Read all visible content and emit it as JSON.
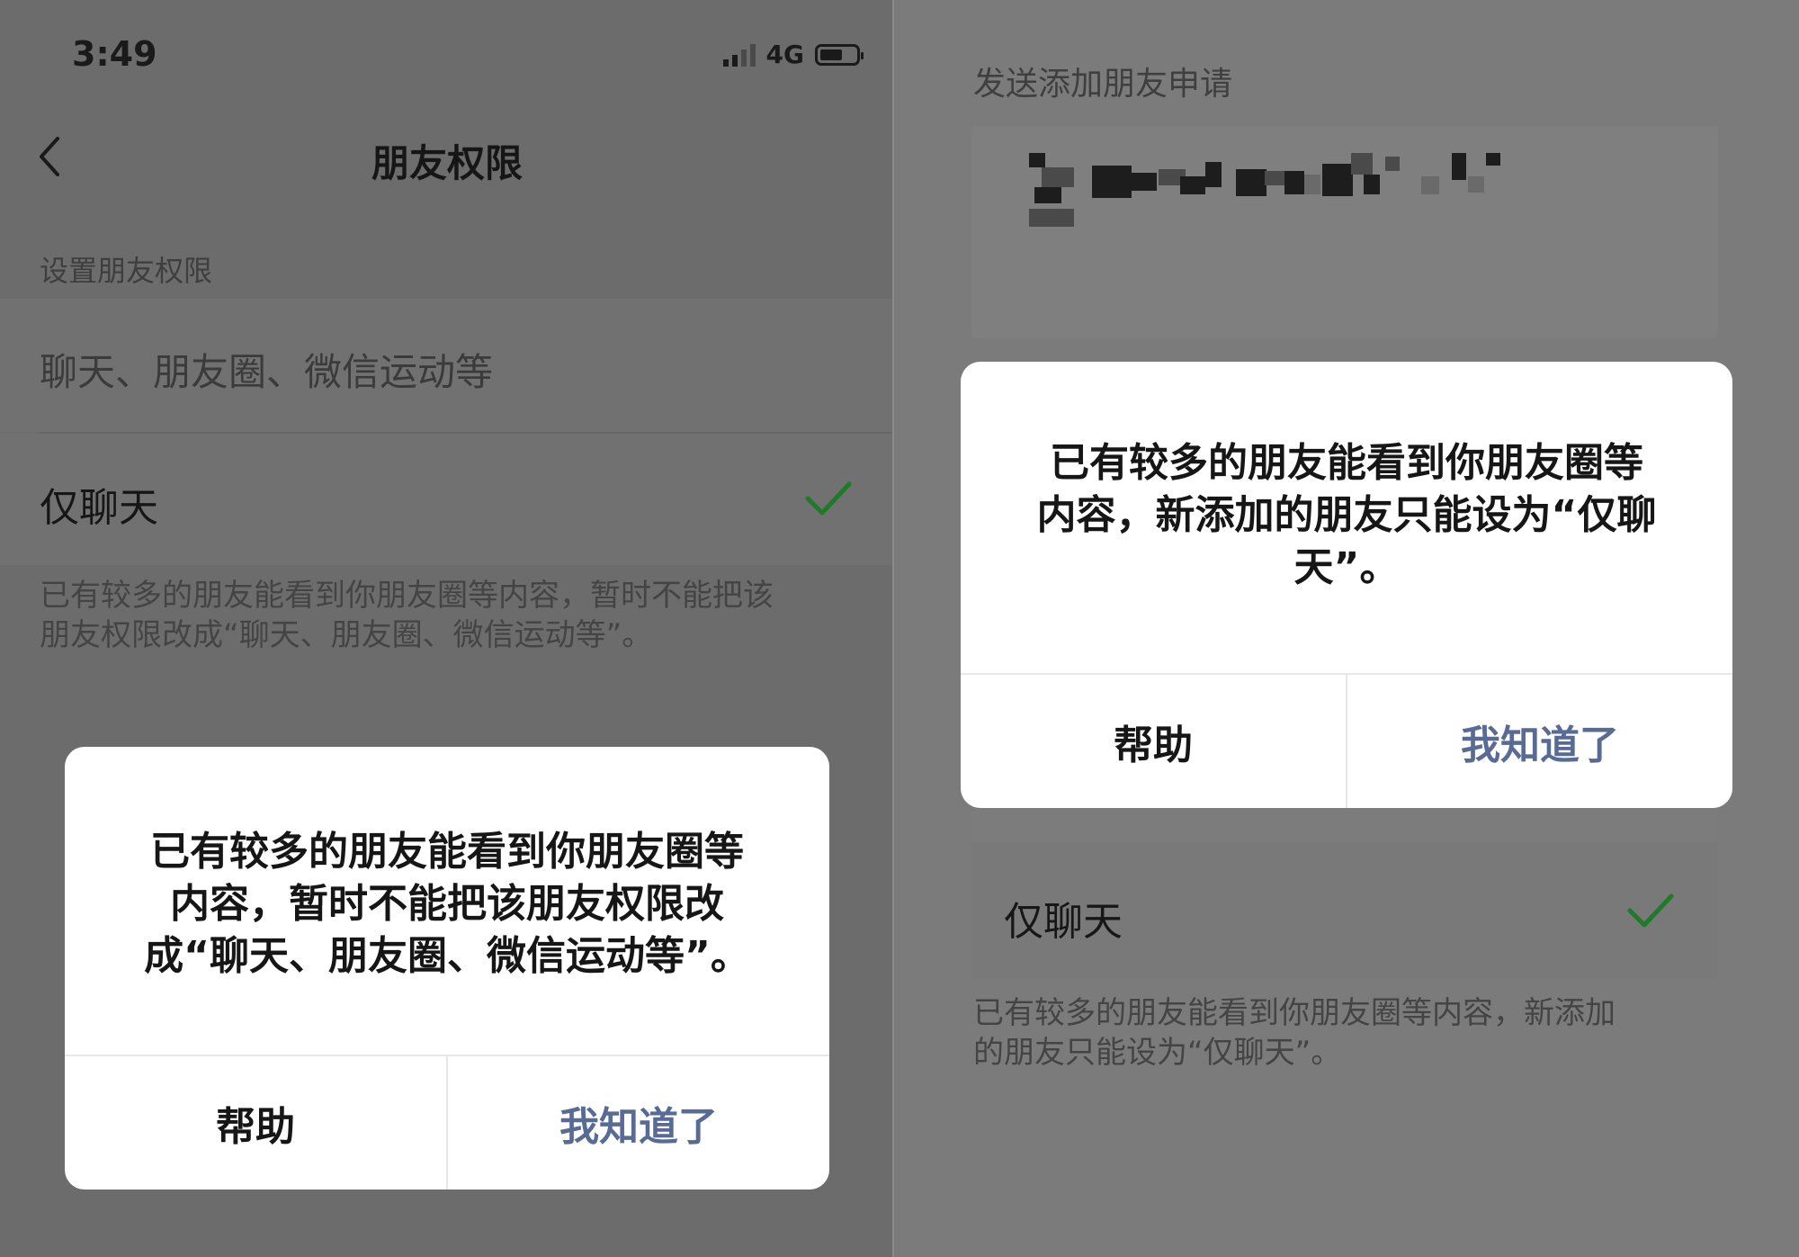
{
  "left": {
    "status_bar": {
      "time": "3:49",
      "network": "4G"
    },
    "nav": {
      "title": "朋友权限"
    },
    "section_label": "设置朋友权限",
    "options": [
      {
        "label": "聊天、朋友圈、微信运动等",
        "selected": false
      },
      {
        "label": "仅聊天",
        "selected": true
      }
    ],
    "footnote": {
      "line1": "已有较多的朋友能看到你朋友圈等内容，暂时不能把该",
      "line2": "朋友权限改成“聊天、朋友圈、微信运动等”。"
    },
    "dialog": {
      "message": {
        "line1": "已有较多的朋友能看到你朋友圈等",
        "line2": "内容，暂时不能把该朋友权限改",
        "line3": "成“聊天、朋友圈、微信运动等”。"
      },
      "help_label": "帮助",
      "ok_label": "我知道了"
    }
  },
  "right": {
    "section_label": "发送添加朋友申请",
    "option": {
      "label": "仅聊天",
      "selected": true
    },
    "footnote": {
      "line1": "已有较多的朋友能看到你朋友圈等内容，新添加",
      "line2": "的朋友只能设为“仅聊天”。"
    },
    "dialog": {
      "message": {
        "line1": "已有较多的朋友能看到你朋友圈等",
        "line2": "内容，新添加的朋友只能设为“仅聊",
        "line3": "天”。"
      },
      "help_label": "帮助",
      "ok_label": "我知道了"
    }
  },
  "colors": {
    "check_green": "#1aad19",
    "link_blue": "#576b95",
    "overlay_gray": "#6c6c6c"
  },
  "icons": [
    "back-chevron-icon",
    "signal-icon",
    "battery-icon",
    "checkmark-icon"
  ]
}
